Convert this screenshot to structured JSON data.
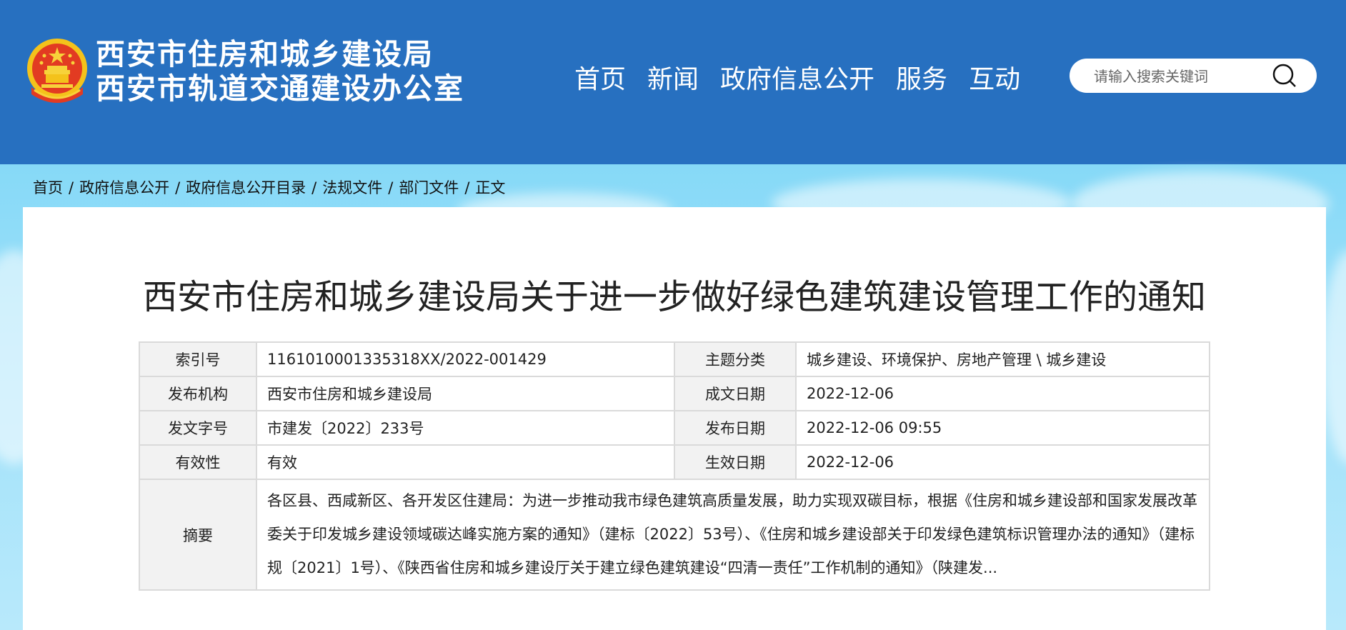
{
  "header": {
    "title_line1": "西安市住房和城乡建设局",
    "title_line2": "西安市轨道交通建设办公室",
    "nav": [
      "首页",
      "新闻",
      "政府信息公开",
      "服务",
      "互动"
    ],
    "search_placeholder": "请输入搜索关键词"
  },
  "breadcrumb": [
    "首页",
    "政府信息公开",
    "政府信息公开目录",
    "法规文件",
    "部门文件",
    "正文"
  ],
  "article": {
    "title": "西安市住房和城乡建设局关于进一步做好绿色建筑建设管理工作的通知"
  },
  "meta": {
    "index_label": "索引号",
    "index_value": "1161010001335318XX/2022-001429",
    "topic_label": "主题分类",
    "topic_value": "城乡建设、环境保护、房地产管理 \\ 城乡建设",
    "publisher_label": "发布机构",
    "publisher_value": "西安市住房和城乡建设局",
    "written_label": "成文日期",
    "written_value": "2022-12-06",
    "docno_label": "发文字号",
    "docno_value": "市建发〔2022〕233号",
    "pubdate_label": "发布日期",
    "pubdate_value": "2022-12-06 09:55",
    "validity_label": "有效性",
    "validity_value": "有效",
    "effective_label": "生效日期",
    "effective_value": "2022-12-06",
    "summary_label": "摘要",
    "summary_value": "各区县、西咸新区、各开发区住建局：为进一步推动我市绿色建筑高质量发展，助力实现双碳目标，根据《住房和城乡建设部和国家发展改革委关于印发城乡建设领域碳达峰实施方案的通知》（建标〔2022〕53号）、《住房和城乡建设部关于印发绿色建筑标识管理办法的通知》（建标规〔2021〕1号）、《陕西省住房和城乡建设厅关于建立绿色建筑建设“四清一责任”工作机制的通知》（陕建发..."
  },
  "colors": {
    "header_bg": "#2770c0",
    "label_bg": "#f2f2f2"
  }
}
